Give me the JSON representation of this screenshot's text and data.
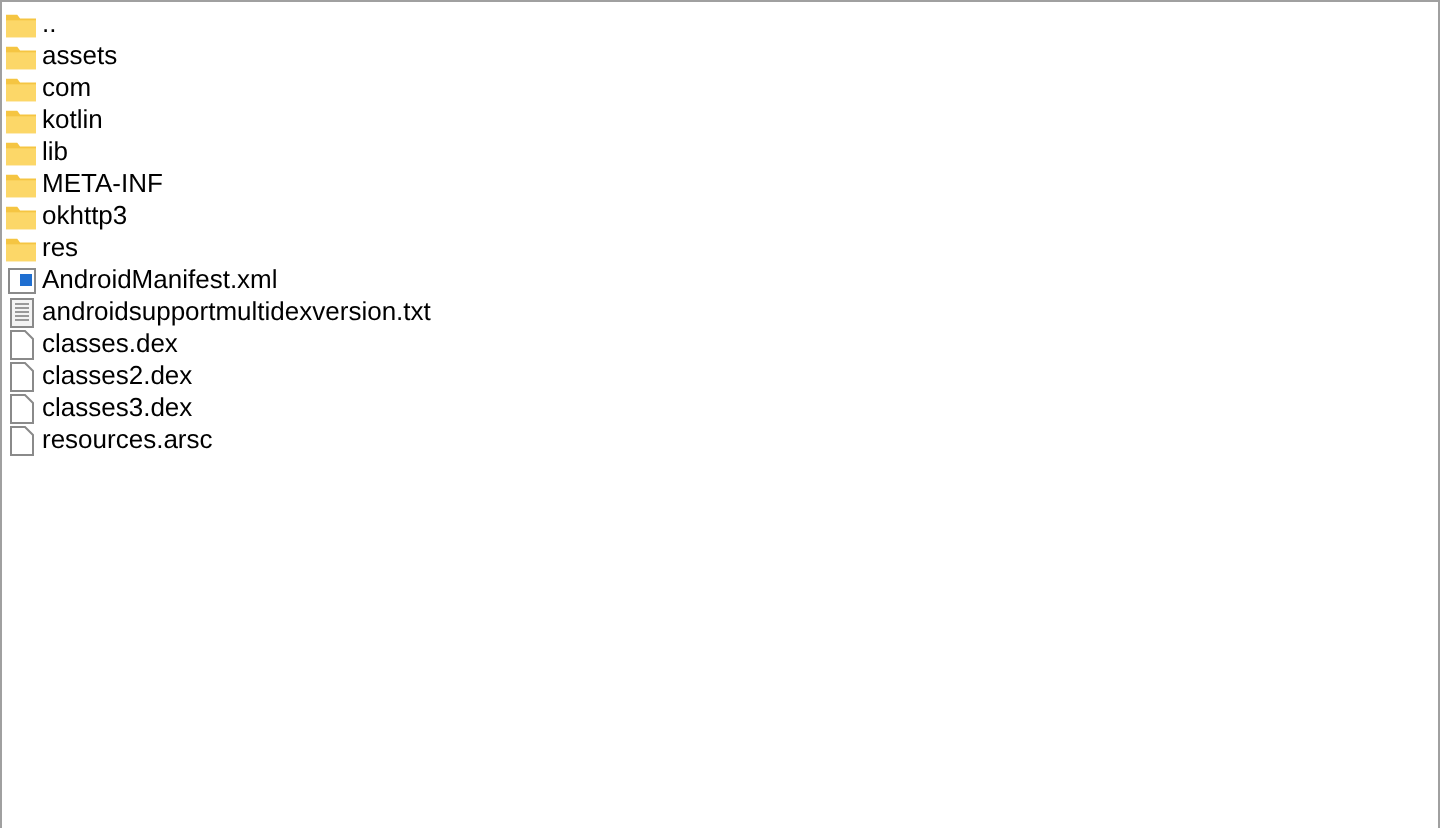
{
  "items": [
    {
      "name": "..",
      "kind": "folder"
    },
    {
      "name": "assets",
      "kind": "folder"
    },
    {
      "name": "com",
      "kind": "folder"
    },
    {
      "name": "kotlin",
      "kind": "folder"
    },
    {
      "name": "lib",
      "kind": "folder"
    },
    {
      "name": "META-INF",
      "kind": "folder"
    },
    {
      "name": "okhttp3",
      "kind": "folder"
    },
    {
      "name": "res",
      "kind": "folder"
    },
    {
      "name": "AndroidManifest.xml",
      "kind": "xml"
    },
    {
      "name": "androidsupportmultidexversion.txt",
      "kind": "text"
    },
    {
      "name": "classes.dex",
      "kind": "file"
    },
    {
      "name": "classes2.dex",
      "kind": "file"
    },
    {
      "name": "classes3.dex",
      "kind": "file"
    },
    {
      "name": "resources.arsc",
      "kind": "file"
    }
  ]
}
